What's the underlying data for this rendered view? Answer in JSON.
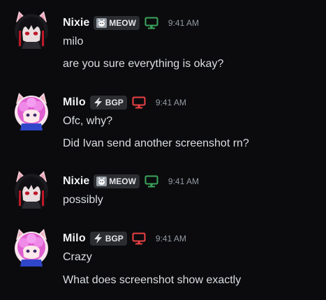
{
  "messages": [
    {
      "author": "Nixie",
      "tag": "MEOW",
      "tag_icon": "cat-icon",
      "device_color": "#3ba55d",
      "time": "9:41 AM",
      "lines": [
        "milo",
        "are you sure everything is okay?"
      ]
    },
    {
      "author": "Milo",
      "tag": "BGP",
      "tag_icon": "lightning-icon",
      "device_color": "#ed4245",
      "time": "9:41 AM",
      "lines": [
        "Ofc, why?",
        "Did Ivan send another screenshot rn?"
      ]
    },
    {
      "author": "Nixie",
      "tag": "MEOW",
      "tag_icon": "cat-icon",
      "device_color": "#3ba55d",
      "time": "9:41 AM",
      "lines": [
        "possibly"
      ]
    },
    {
      "author": "Milo",
      "tag": "BGP",
      "tag_icon": "lightning-icon",
      "device_color": "#ed4245",
      "time": "9:41 AM",
      "lines": [
        "Crazy",
        "What does screenshot show exactly"
      ]
    }
  ]
}
